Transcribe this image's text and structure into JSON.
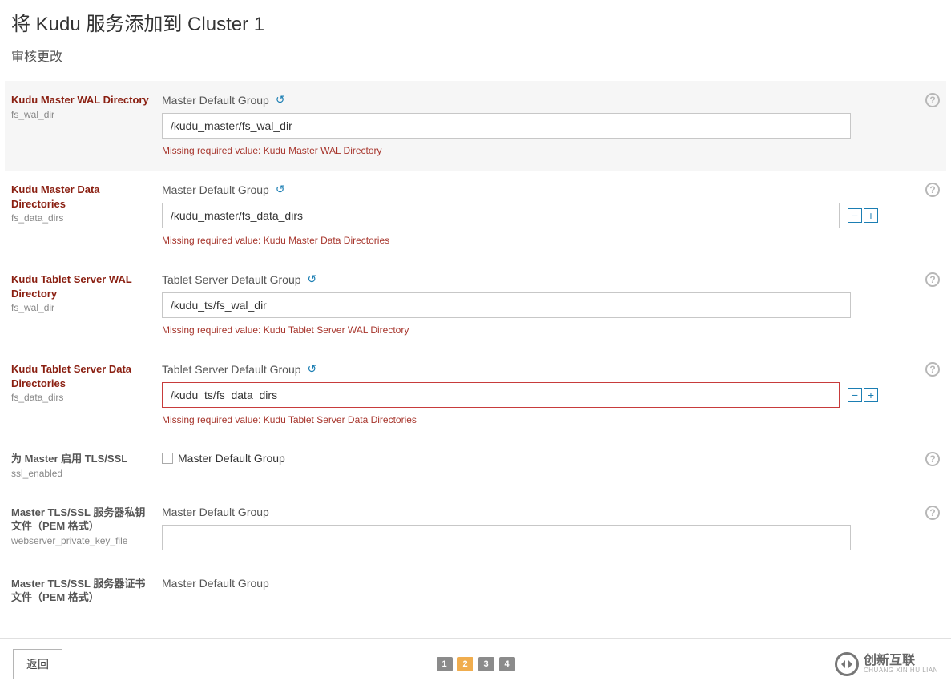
{
  "page": {
    "title": "将 Kudu 服务添加到 Cluster 1",
    "subtitle": "审核更改"
  },
  "groups": {
    "master_default": "Master Default Group",
    "tablet_default": "Tablet Server Default Group"
  },
  "fields": {
    "master_wal": {
      "label": "Kudu Master WAL Directory",
      "sub": "fs_wal_dir",
      "value": "/kudu_master/fs_wal_dir",
      "error": "Missing required value: Kudu Master WAL Directory"
    },
    "master_data": {
      "label": "Kudu Master Data Directories",
      "sub": "fs_data_dirs",
      "value": "/kudu_master/fs_data_dirs",
      "error": "Missing required value: Kudu Master Data Directories"
    },
    "ts_wal": {
      "label": "Kudu Tablet Server WAL Directory",
      "sub": "fs_wal_dir",
      "value": "/kudu_ts/fs_wal_dir",
      "error": "Missing required value: Kudu Tablet Server WAL Directory"
    },
    "ts_data": {
      "label": "Kudu Tablet Server Data Directories",
      "sub": "fs_data_dirs",
      "value": "/kudu_ts/fs_data_dirs",
      "error": "Missing required value: Kudu Tablet Server Data Directories"
    },
    "ssl_enabled": {
      "label": "为 Master 启用 TLS/SSL",
      "sub": "ssl_enabled"
    },
    "pem_key": {
      "label": "Master TLS/SSL 服务器私钥文件（PEM 格式）",
      "sub": "webserver_private_key_file",
      "value": ""
    },
    "pem_cert": {
      "label": "Master TLS/SSL 服务器证书文件（PEM 格式）"
    }
  },
  "footer": {
    "back": "返回",
    "steps": [
      "1",
      "2",
      "3",
      "4"
    ],
    "active_step": 2,
    "brand_cn": "创新互联",
    "brand_en": "CHUANG XIN HU LIAN"
  }
}
